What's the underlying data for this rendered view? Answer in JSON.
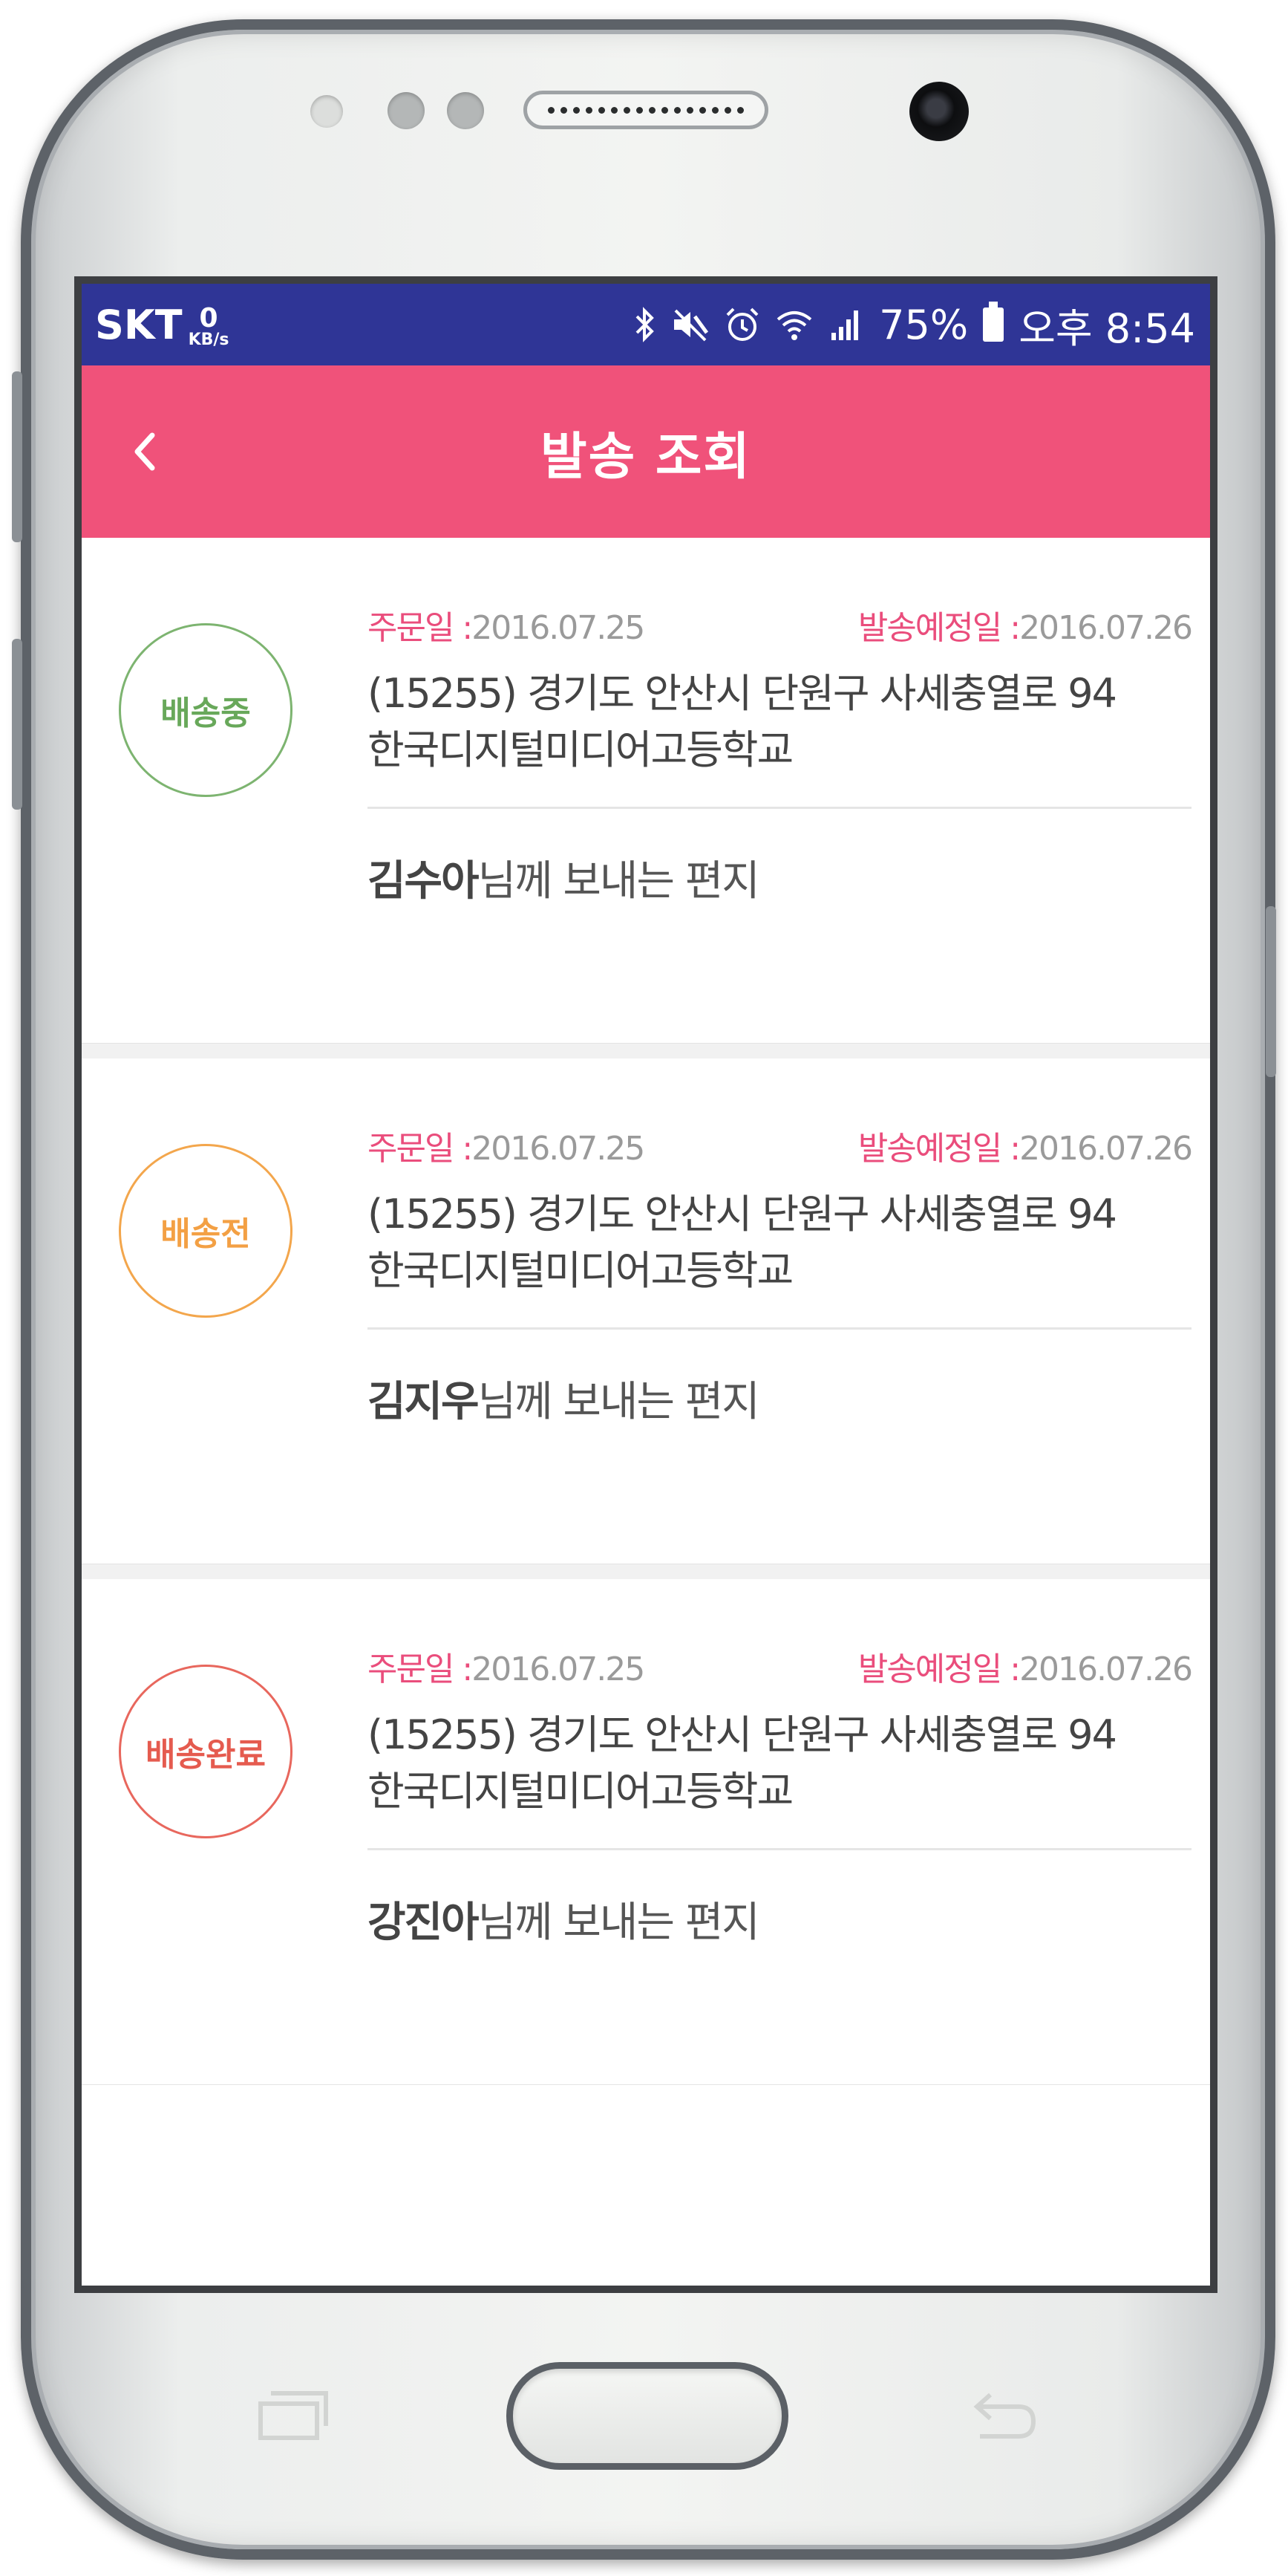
{
  "status_bar": {
    "carrier": "SKT",
    "net_speed_value": "0",
    "net_speed_unit": "KB/s",
    "battery": "75%",
    "time": "오후 8:54"
  },
  "header": {
    "title": "발송 조회",
    "back_icon": "chevron-left-icon"
  },
  "labels": {
    "order_date": "주문일 :",
    "ship_date": "발송예정일 :",
    "recipient_suffix": "님께 보내는 편지"
  },
  "shipments": [
    {
      "status": "배송중",
      "status_color": "#68a85a",
      "order_date": "2016.07.25",
      "ship_date": "2016.07.26",
      "address_line1": "(15255) 경기도 안산시 단원구 사세충열로 94",
      "address_line2": "한국디지털미디어고등학교",
      "recipient": "김수아"
    },
    {
      "status": "배송전",
      "status_color": "#f3a044",
      "order_date": "2016.07.25",
      "ship_date": "2016.07.26",
      "address_line1": "(15255) 경기도 안산시 단원구 사세충열로 94",
      "address_line2": "한국디지털미디어고등학교",
      "recipient": "김지우"
    },
    {
      "status": "배송완료",
      "status_color": "#e55b4f",
      "order_date": "2016.07.25",
      "ship_date": "2016.07.26",
      "address_line1": "(15255) 경기도 안산시 단원구 사세충열로 94",
      "address_line2": "한국디지털미디어고등학교",
      "recipient": "강진아"
    }
  ],
  "colors": {
    "status_bar_bg": "#2f3596",
    "header_bg": "#f0527a",
    "date_label": "#ea4d7c"
  }
}
